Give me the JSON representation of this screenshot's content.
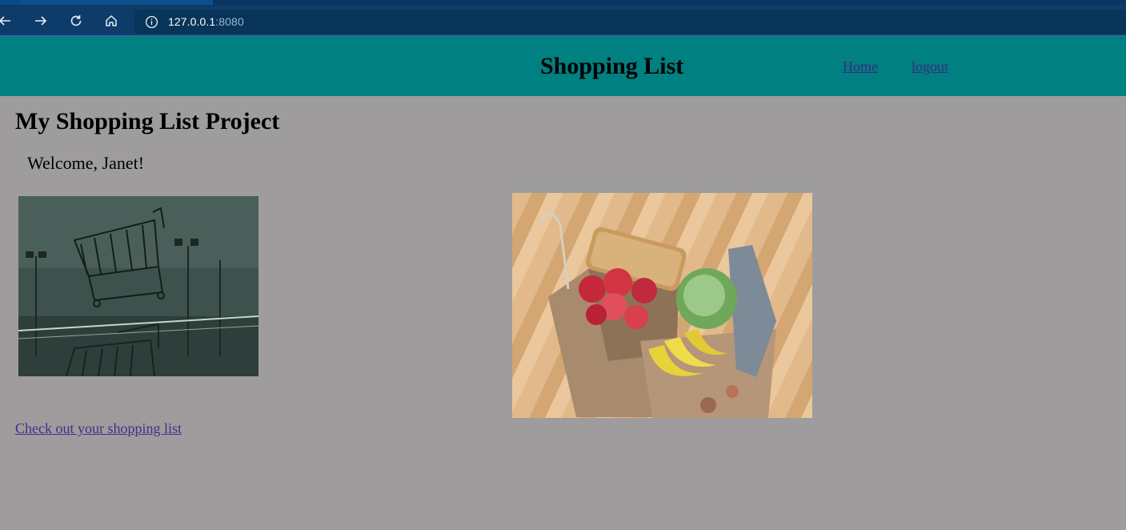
{
  "browser": {
    "address": {
      "host": "127.0.0.1",
      "port": ":8080"
    },
    "icons": [
      "back-icon",
      "forward-icon",
      "reload-icon",
      "home-icon",
      "info-icon"
    ]
  },
  "header": {
    "title": "Shopping List",
    "nav": {
      "home": "Home",
      "logout": "logout"
    },
    "background": "#008080"
  },
  "main": {
    "heading": "My Shopping List Project",
    "welcome": "Welcome, Janet!",
    "link": "Check out your shopping list",
    "background": "#9e9c9d"
  }
}
